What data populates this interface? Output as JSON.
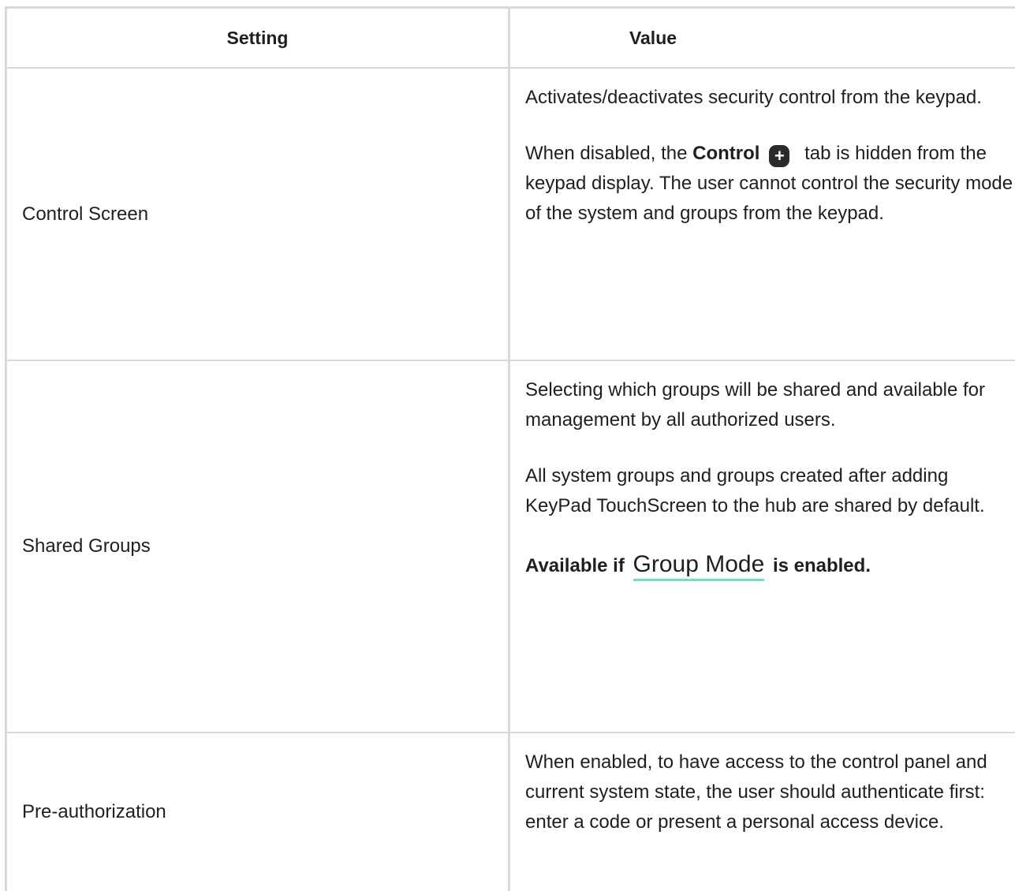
{
  "table": {
    "header": {
      "setting": "Setting",
      "value": "Value"
    },
    "rows": [
      {
        "setting": "Control Screen",
        "para1": "Activates/deactivates security control from the keypad.",
        "para2_prefix": "When disabled, the ",
        "para2_bold": "Control",
        "para2_suffix": " tab is hidden from the keypad display. The user cannot control the security mode of the system and groups from the keypad."
      },
      {
        "setting": "Shared Groups",
        "para1": "Selecting which groups will be shared and available for management by all authorized users.",
        "para2": "All system groups and groups created after adding KeyPad TouchScreen to the hub are shared by default.",
        "note_prefix": "Available if",
        "note_link": "Group Mode",
        "note_suffix": "is enabled."
      },
      {
        "setting": "Pre-authorization",
        "para1": "When enabled, to have access to the control panel and current system state, the user should authenticate first: enter a code or present a personal access device."
      }
    ]
  },
  "icons": {
    "control_tab_icon": "plus-icon",
    "control_tab_glyph": "+"
  },
  "colors": {
    "link_underline": "#6fe0b4",
    "border": "#d9d9d9"
  }
}
